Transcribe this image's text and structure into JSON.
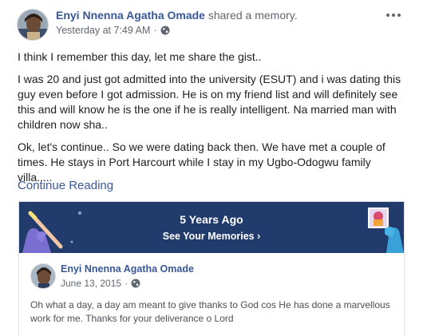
{
  "post": {
    "author": "Enyi Nnenna Agatha Omade",
    "action": "shared a memory.",
    "timestamp": "Yesterday at 7:49 AM",
    "separator": "·",
    "privacy_icon": "globe-icon",
    "more_icon": "more-options-icon",
    "paragraphs": [
      "I think I remember this day, let me share the gist..",
      "I was 20 and just got admitted into the university (ESUT) and i was dating this guy even before I got admission. He is on my friend list and will definitely see this and will know he is the one if he is really intelligent. Na married man with children now sha..",
      "Ok, let's continue.. So we were dating back then. We have met a couple of times. He stays in Port Harcourt while I stay in my Ugbo-Odogwu family villa....."
    ],
    "continue_label": "Continue Reading"
  },
  "memory": {
    "title": "5 Years Ago",
    "link_label": "See Your Memories",
    "chevron": "›",
    "banner_color": "#203b6c",
    "original_post": {
      "author": "Enyi Nnenna Agatha Omade",
      "date": "June 13, 2015",
      "separator": "·",
      "privacy_icon": "globe-icon",
      "text": "Oh what a day, a day am meant to give thanks to God cos He has done a marvellous work for me. Thanks for your deliverance o Lord"
    }
  },
  "colors": {
    "link": "#385898",
    "meta": "#616770",
    "text": "#1c1e21"
  }
}
